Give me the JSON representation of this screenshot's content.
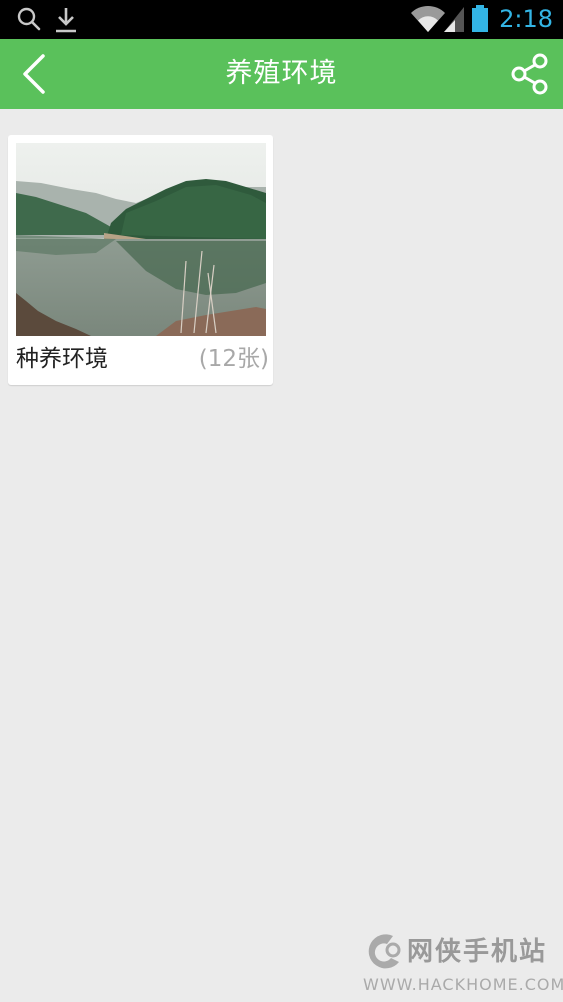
{
  "status_bar": {
    "time": "2:18",
    "icons": [
      "search-icon",
      "download-icon",
      "wifi-icon",
      "signal-icon",
      "battery-icon"
    ]
  },
  "app_bar": {
    "title": "养殖环境",
    "back_icon": "chevron-left-icon",
    "share_icon": "share-icon"
  },
  "albums": [
    {
      "name": "种养环境",
      "count": "(12张)"
    }
  ],
  "watermark": {
    "name": "网侠手机站",
    "url": "WWW.HACKHOME.COM"
  },
  "colors": {
    "app_bar": "#5ac15b",
    "background": "#ebebeb",
    "status_time": "#33b5e5"
  }
}
